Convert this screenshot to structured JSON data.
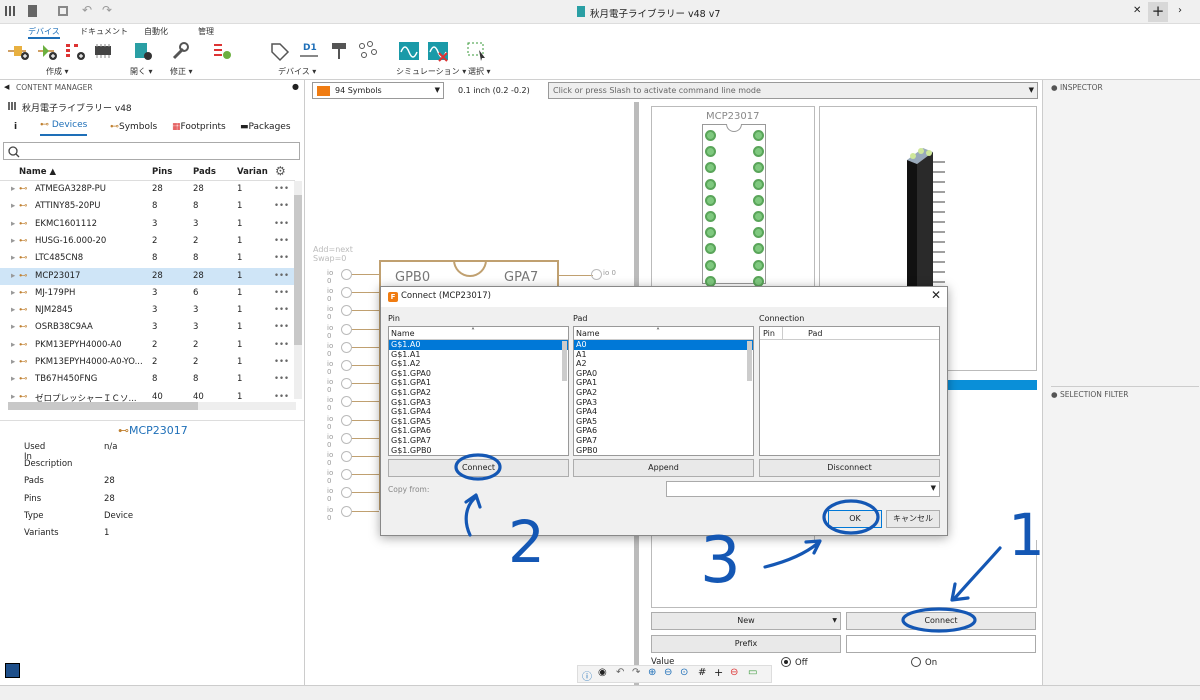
{
  "window": {
    "title": "秋月電子ライブラリー v48 v7",
    "close": "✕",
    "plus": "+"
  },
  "ribbon": {
    "tabs": [
      "デバイス",
      "ドキュメント",
      "自動化",
      "管理"
    ],
    "groups": [
      "作成",
      "開く",
      "修正",
      "デバイス",
      "シミュレーション",
      "選択"
    ],
    "d1_label": "D1"
  },
  "left": {
    "header": "CONTENT MANAGER",
    "library": "秋月電子ライブラリー v48",
    "tabs": [
      "Devices",
      "Symbols",
      "Footprints",
      "Packages"
    ],
    "columns": [
      "Name",
      "Pins",
      "Pads",
      "Varian"
    ],
    "rows": [
      {
        "name": "ATMEGA328P-PU",
        "pins": "28",
        "pads": "28",
        "var": "1"
      },
      {
        "name": "ATTINY85-20PU",
        "pins": "8",
        "pads": "8",
        "var": "1"
      },
      {
        "name": "EKMC1601112",
        "pins": "3",
        "pads": "3",
        "var": "1"
      },
      {
        "name": "HUSG-16.000-20",
        "pins": "2",
        "pads": "2",
        "var": "1"
      },
      {
        "name": "LTC485CN8",
        "pins": "8",
        "pads": "8",
        "var": "1"
      },
      {
        "name": "MCP23017",
        "pins": "28",
        "pads": "28",
        "var": "1"
      },
      {
        "name": "MJ-179PH",
        "pins": "3",
        "pads": "6",
        "var": "1"
      },
      {
        "name": "NJM2845",
        "pins": "3",
        "pads": "3",
        "var": "1"
      },
      {
        "name": "OSRB38C9AA",
        "pins": "3",
        "pads": "3",
        "var": "1"
      },
      {
        "name": "PKM13EPYH4000-A0",
        "pins": "2",
        "pads": "2",
        "var": "1"
      },
      {
        "name": "PKM13EPYH4000-A0-YO...",
        "pins": "2",
        "pads": "2",
        "var": "1"
      },
      {
        "name": "TB67H450FNG",
        "pins": "8",
        "pads": "8",
        "var": "1"
      },
      {
        "name": "ゼロプレッシャーＩＣソ...",
        "pins": "40",
        "pads": "40",
        "var": "1"
      }
    ],
    "selected_row": "MCP23017",
    "detail_title": "MCP23017",
    "props": [
      {
        "k": "Used In",
        "v": "n/a"
      },
      {
        "k": "Description",
        "v": ""
      },
      {
        "k": "Pads",
        "v": "28"
      },
      {
        "k": "Pins",
        "v": "28"
      },
      {
        "k": "Type",
        "v": "Device"
      },
      {
        "k": "Variants",
        "v": "1"
      }
    ]
  },
  "canvas": {
    "symbols_dropdown": "94 Symbols",
    "grid_text": "0.1 inch (0.2 -0.2)",
    "command_placeholder": "Click or press Slash to activate command line mode",
    "add_hint": "Add=next",
    "swap_hint": "Swap=0",
    "sym_left": "GPB0",
    "sym_right": "GPA7",
    "io_label": "io 0",
    "pkg_title": "MCP23017"
  },
  "right": {
    "inspector": "INSPECTOR",
    "selection_filter": "SELECTION FILTER"
  },
  "dialog": {
    "title": "Connect (MCP23017)",
    "pin_label": "Pin",
    "pad_label": "Pad",
    "conn_label": "Connection",
    "col_name": "Name",
    "conn_cols": [
      "Pin",
      "Pad"
    ],
    "pins": [
      "G$1.A0",
      "G$1.A1",
      "G$1.A2",
      "G$1.GPA0",
      "G$1.GPA1",
      "G$1.GPA2",
      "G$1.GPA3",
      "G$1.GPA4",
      "G$1.GPA5",
      "G$1.GPA6",
      "G$1.GPA7",
      "G$1.GPB0"
    ],
    "pads": [
      "A0",
      "A1",
      "A2",
      "GPA0",
      "GPA1",
      "GPA2",
      "GPA3",
      "GPA4",
      "GPA5",
      "GPA6",
      "GPA7",
      "GPB0"
    ],
    "connect": "Connect",
    "append": "Append",
    "disconnect": "Disconnect",
    "copy_from": "Copy from:",
    "ok": "OK",
    "cancel": "キャンセル"
  },
  "bottom": {
    "new_btn": "New",
    "connect_btn": "Connect",
    "prefix_btn": "Prefix",
    "value_label": "Value",
    "off": "Off",
    "on": "On"
  },
  "annotations": {
    "n1": "1",
    "n2": "2",
    "n3": "3"
  },
  "colors": {
    "accent": "#0078d7",
    "ink": "#1457b4",
    "wire": "#c0a070",
    "pad": "#7fc97f"
  }
}
